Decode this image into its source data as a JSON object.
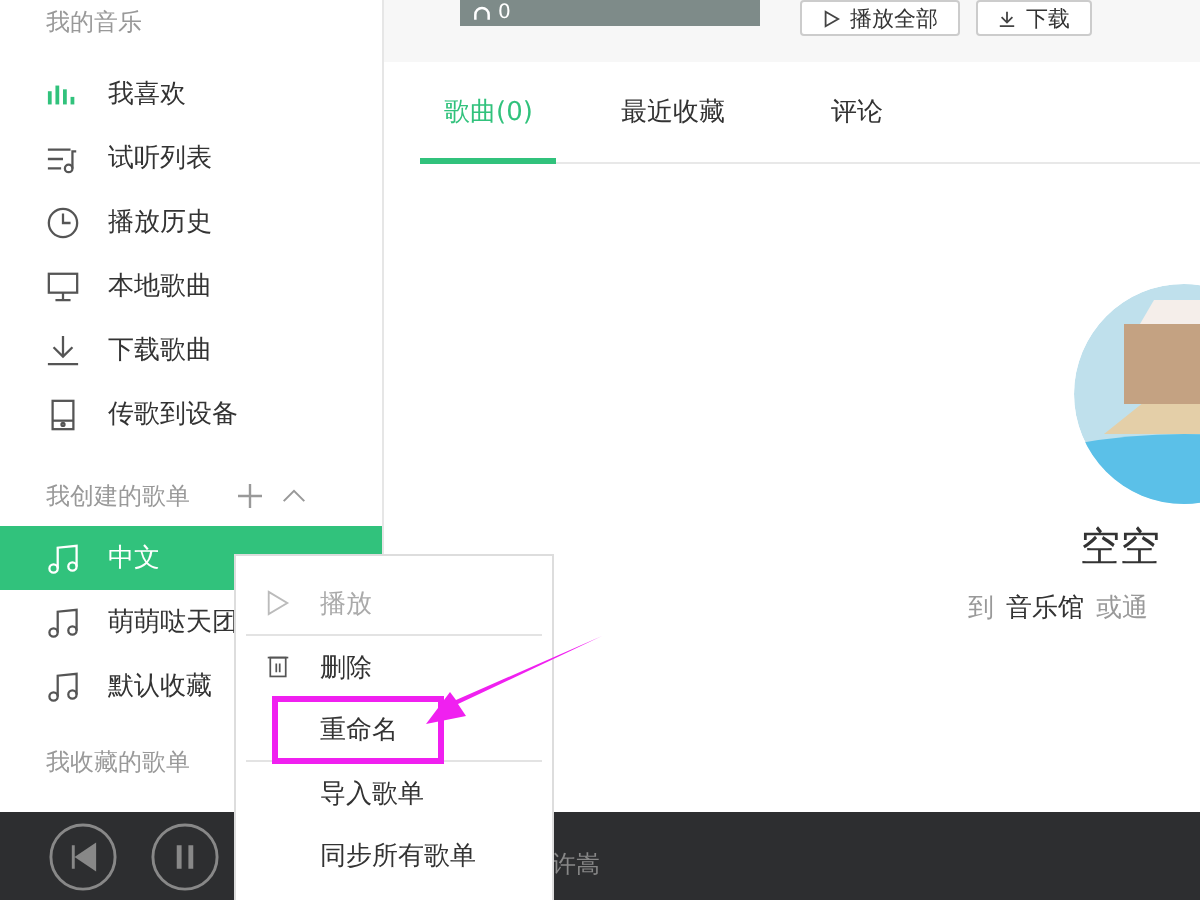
{
  "sidebar": {
    "my_music": {
      "heading": "我的音乐",
      "items": [
        {
          "label": "我喜欢",
          "kind": "bars"
        },
        {
          "label": "试听列表",
          "kind": "playlist"
        },
        {
          "label": "播放历史",
          "kind": "clock"
        },
        {
          "label": "本地歌曲",
          "kind": "monitor"
        },
        {
          "label": "下载歌曲",
          "kind": "download"
        },
        {
          "label": "传歌到设备",
          "kind": "device"
        }
      ]
    },
    "created_playlists": {
      "heading": "我创建的歌单",
      "items": [
        {
          "label": "中文",
          "selected": true
        },
        {
          "label": "萌萌哒天团",
          "selected": false
        },
        {
          "label": "默认收藏",
          "selected": false
        }
      ]
    },
    "collected_playlists": {
      "heading": "我收藏的歌单"
    }
  },
  "header": {
    "play_count": "0",
    "buttons": [
      {
        "label": "播放全部",
        "kind": "play"
      },
      {
        "label": "下载",
        "kind": "download"
      }
    ]
  },
  "tabs": [
    {
      "label": "歌曲(0)",
      "selected": true
    },
    {
      "label": "最近收藏",
      "selected": false
    },
    {
      "label": "评论",
      "selected": false
    }
  ],
  "empty_state": {
    "title": "空空",
    "hint_before": "到",
    "hint_link": "音乐馆",
    "hint_after": "或通"
  },
  "context_menu": {
    "items": [
      {
        "label": "播放",
        "kind": "play",
        "disabled": true,
        "highlighted": false,
        "separator_after": true
      },
      {
        "label": "删除",
        "kind": "trash",
        "disabled": false,
        "highlighted": false,
        "separator_after": false
      },
      {
        "label": "重命名",
        "disabled": false,
        "highlighted": true,
        "separator_after": true
      },
      {
        "label": "导入歌单",
        "disabled": false,
        "highlighted": false,
        "separator_after": false
      },
      {
        "label": "同步所有歌单",
        "disabled": false,
        "highlighted": false,
        "separator_after": false
      }
    ]
  },
  "player": {
    "artist": "许嵩"
  }
}
